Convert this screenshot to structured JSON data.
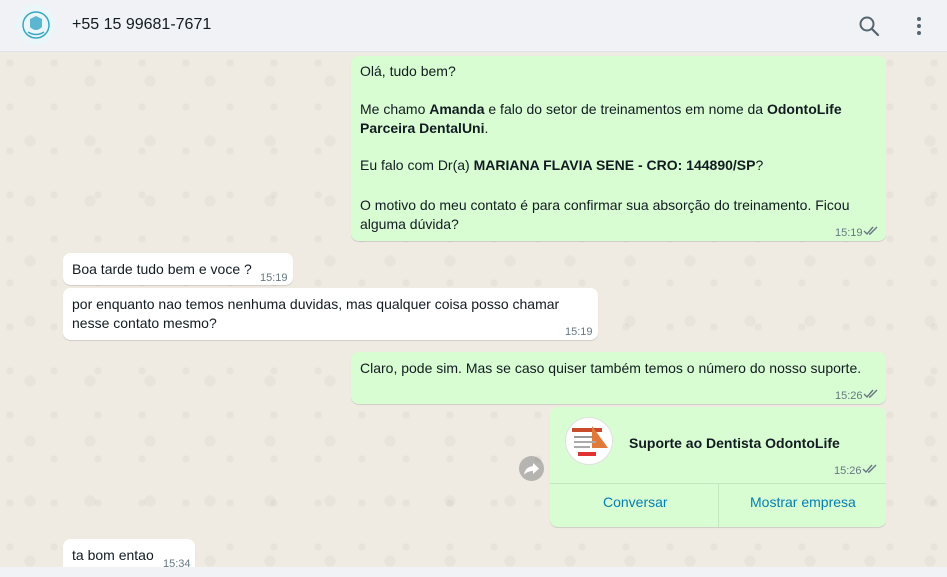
{
  "header": {
    "contact": "+55 15 99681-7671",
    "search_icon": "search-icon",
    "menu_icon": "more-vert-icon"
  },
  "messages": [
    {
      "direction": "out",
      "lines": {
        "l1": "Olá, tudo bem?",
        "l2a": "Me chamo ",
        "l2b": "Amanda",
        "l2c": " e falo do setor de treinamentos em nome da ",
        "l2d": "OdontoLife",
        "l3": "Parceira DentalUni",
        "l3b": ".",
        "l4a": " Eu falo com Dr(a) ",
        "l4b": "MARIANA FLAVIA SENE - CRO: 144890/SP",
        "l4c": "?",
        "l5": "O motivo do meu contato é para confirmar sua absorção do treinamento. Ficou",
        "l6": "alguma dúvida?"
      },
      "time": "15:19",
      "status": "read"
    },
    {
      "direction": "in",
      "text": "Boa tarde tudo bem e voce ?",
      "time": "15:19"
    },
    {
      "direction": "in",
      "line1": "por enquanto nao temos nenhuma duvidas, mas qualquer coisa posso chamar",
      "line2": "nesse contato mesmo?",
      "time": "15:19"
    },
    {
      "direction": "out",
      "text": "Claro, pode sim. Mas se caso quiser também temos o número do nosso suporte.",
      "time": "15:26",
      "status": "read"
    },
    {
      "direction": "out",
      "type": "contact-card",
      "name": "Suporte ao Dentista OdontoLife",
      "time": "15:26",
      "status": "read",
      "action_left": "Conversar",
      "action_right": "Mostrar empresa"
    },
    {
      "direction": "in",
      "text": "ta bom entao",
      "time": "15:34"
    }
  ],
  "colors": {
    "incoming": "#ffffff",
    "outgoing": "#d9fdd3",
    "link": "#027eb5",
    "read_ticks": "#667781"
  }
}
